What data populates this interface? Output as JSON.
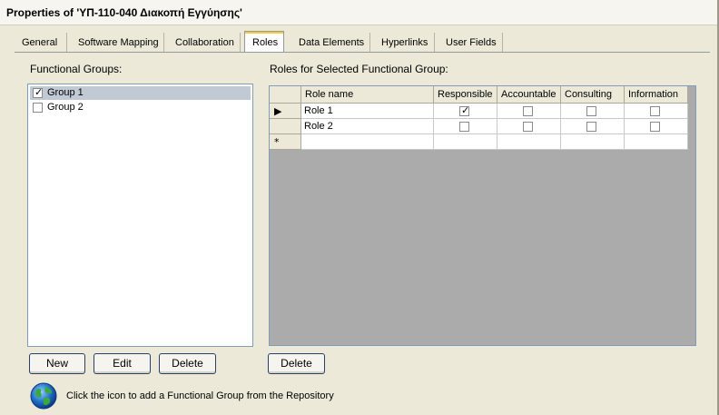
{
  "window": {
    "title": "Properties of 'ΥΠ-110-040 Διακοπή Εγγύησης'"
  },
  "tabs": [
    {
      "label": "General"
    },
    {
      "label": "Software Mapping"
    },
    {
      "label": "Collaboration"
    },
    {
      "label": "Roles",
      "active": true
    },
    {
      "label": "Data Elements"
    },
    {
      "label": "Hyperlinks"
    },
    {
      "label": "User Fields"
    }
  ],
  "functional_groups": {
    "label": "Functional Groups:",
    "items": [
      {
        "label": "Group 1",
        "checked": true,
        "selected": true
      },
      {
        "label": "Group 2",
        "checked": false,
        "selected": false
      }
    ],
    "buttons": {
      "new": "New",
      "edit": "Edit",
      "delete": "Delete"
    }
  },
  "roles": {
    "label": "Roles for Selected Functional Group:",
    "columns": [
      "Role name",
      "Responsible",
      "Accountable",
      "Consulting",
      "Information"
    ],
    "rows": [
      {
        "name": "Role 1",
        "responsible": true,
        "accountable": false,
        "consulting": false,
        "information": false,
        "current": true
      },
      {
        "name": "Role 2",
        "responsible": false,
        "accountable": false,
        "consulting": false,
        "information": false,
        "current": false
      }
    ],
    "new_row_marker": "*",
    "delete_button": "Delete"
  },
  "hint": {
    "text": "Click the icon to add a Functional Group from the Repository",
    "icon": "globe-icon"
  },
  "colors": {
    "selection": "#c1c9d5",
    "tab_highlight": "#ffc83c",
    "dialog_bg": "#ece9d8"
  }
}
